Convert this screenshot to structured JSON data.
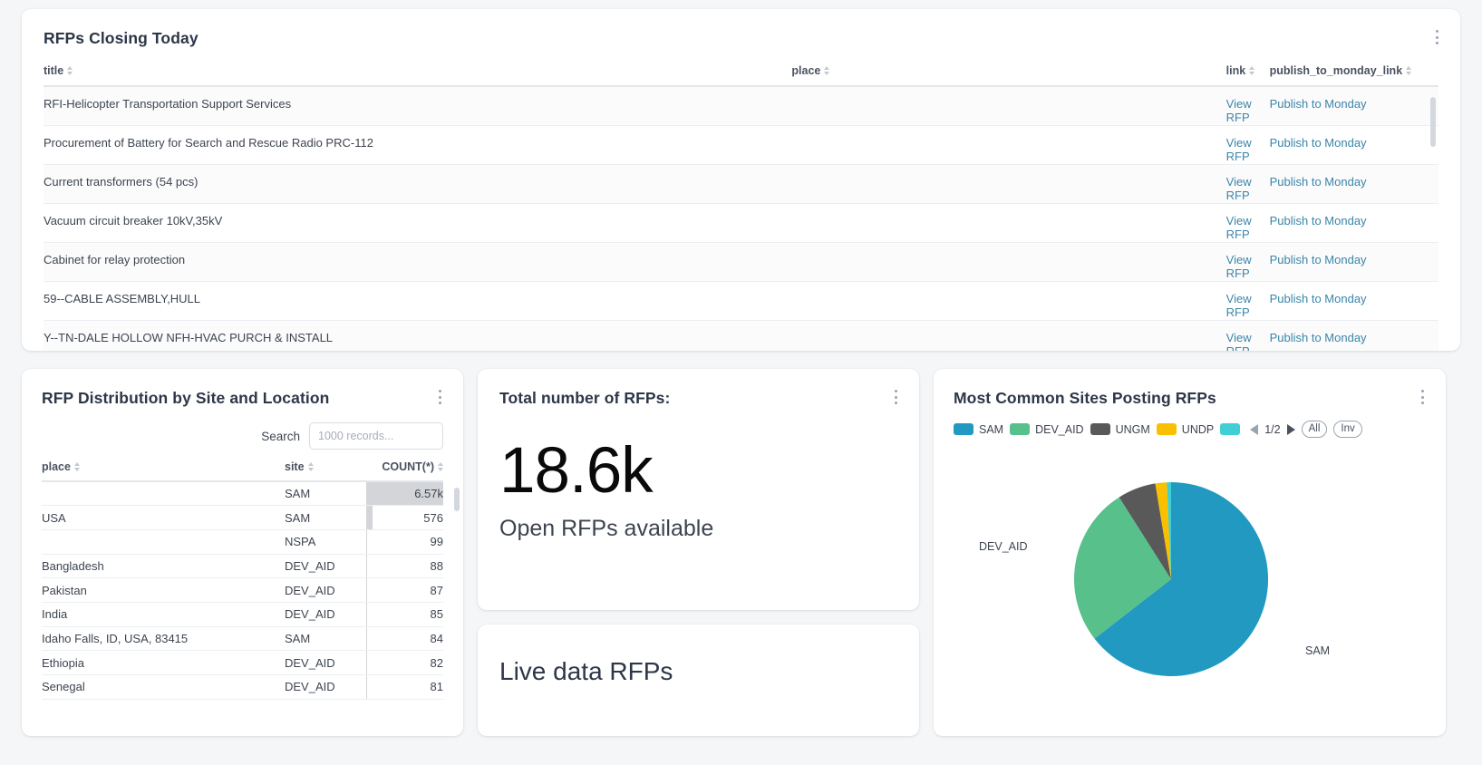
{
  "closing": {
    "title": "RFPs Closing Today",
    "columns": [
      {
        "key": "title",
        "label": "title"
      },
      {
        "key": "place",
        "label": "place"
      },
      {
        "key": "link",
        "label": "link"
      },
      {
        "key": "publish",
        "label": "publish_to_monday_link"
      }
    ],
    "rows": [
      {
        "title": "RFI-Helicopter Transportation Support Services",
        "place": "",
        "link": "View RFP",
        "publish": "Publish to Monday"
      },
      {
        "title": "Procurement of Battery for Search and Rescue Radio PRC-112",
        "place": "",
        "link": "View RFP",
        "publish": "Publish to Monday"
      },
      {
        "title": "Current transformers (54 pcs)",
        "place": "",
        "link": "View RFP",
        "publish": "Publish to Monday"
      },
      {
        "title": "Vacuum circuit breaker 10kV,35kV",
        "place": "",
        "link": "View RFP",
        "publish": "Publish to Monday"
      },
      {
        "title": "Cabinet for relay protection",
        "place": "",
        "link": "View RFP",
        "publish": "Publish to Monday"
      },
      {
        "title": "59--CABLE ASSEMBLY,HULL",
        "place": "",
        "link": "View RFP",
        "publish": "Publish to Monday"
      },
      {
        "title": "Y--TN-DALE HOLLOW NFH-HVAC PURCH & INSTALL",
        "place": "",
        "link": "View RFP",
        "publish": "Publish to Monday"
      }
    ]
  },
  "distribution": {
    "title": "RFP Distribution by Site and Location",
    "search_label": "Search",
    "search_placeholder": "1000 records...",
    "search_value": "",
    "columns": [
      {
        "key": "place",
        "label": "place"
      },
      {
        "key": "site",
        "label": "site"
      },
      {
        "key": "count",
        "label": "COUNT(*)"
      }
    ],
    "rows": [
      {
        "place": "",
        "site": "SAM",
        "count": "6.57k",
        "bar_pct": 100
      },
      {
        "place": "USA",
        "site": "SAM",
        "count": "576",
        "bar_pct": 8.8
      },
      {
        "place": "",
        "site": "NSPA",
        "count": "99",
        "bar_pct": 1.5
      },
      {
        "place": "Bangladesh",
        "site": "DEV_AID",
        "count": "88",
        "bar_pct": 1.3
      },
      {
        "place": "Pakistan",
        "site": "DEV_AID",
        "count": "87",
        "bar_pct": 1.3
      },
      {
        "place": "India",
        "site": "DEV_AID",
        "count": "85",
        "bar_pct": 1.3
      },
      {
        "place": "Idaho Falls, ID, USA, 83415",
        "site": "SAM",
        "count": "84",
        "bar_pct": 1.3
      },
      {
        "place": "Ethiopia",
        "site": "DEV_AID",
        "count": "82",
        "bar_pct": 1.2
      },
      {
        "place": "Senegal",
        "site": "DEV_AID",
        "count": "81",
        "bar_pct": 1.2
      }
    ]
  },
  "total": {
    "title": "Total number of RFPs:",
    "value": "18.6k",
    "subtitle": "Open RFPs available"
  },
  "live": {
    "title": "Live data RFPs"
  },
  "pie_card": {
    "title": "Most Common Sites Posting RFPs",
    "page_indicator": "1/2",
    "all_label": "All",
    "inv_label": "Inv"
  },
  "chart_data": {
    "type": "pie",
    "title": "Most Common Sites Posting RFPs",
    "legend_position": "top",
    "labels": [
      "SAM",
      "DEV_AID",
      "UNGM",
      "UNDP",
      ""
    ],
    "values": [
      64.5,
      26.5,
      6.4,
      1.9,
      0.7
    ],
    "colors": [
      "#2299c0",
      "#58c08a",
      "#595959",
      "#f9c000",
      "#41cfd6"
    ],
    "annotations": [
      {
        "text": "SAM",
        "position": "right"
      },
      {
        "text": "DEV_AID",
        "position": "left"
      }
    ]
  }
}
